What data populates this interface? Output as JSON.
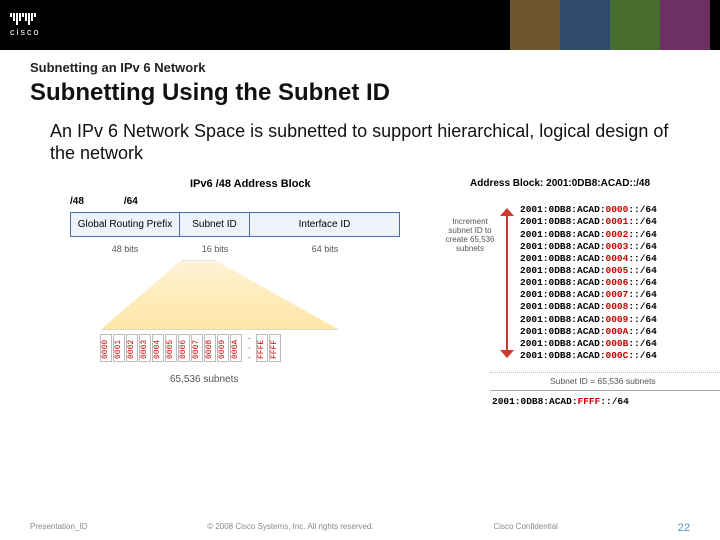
{
  "brand": "cisco",
  "kicker": "Subnetting an IPv 6 Network",
  "title": "Subnetting Using the Subnet ID",
  "body": "An IPv 6 Network Space is subnetted to support hierarchical, logical design of the network",
  "diagram": {
    "block_title": "IPv6 /48 Address Block",
    "row": {
      "a": "/48",
      "b": "/64"
    },
    "boxes": {
      "b1": "Global Routing Prefix",
      "b2": "Subnet ID",
      "b3": "Interface ID"
    },
    "bits": {
      "b1": "48 bits",
      "b2": "16 bits",
      "b3": "64 bits"
    },
    "subnet_ids": [
      "0000",
      "0001",
      "0002",
      "0003",
      "0004",
      "0005",
      "0006",
      "0007",
      "0008",
      "0009",
      "000A"
    ],
    "ellipsis": ". . .",
    "tail_ids": [
      "FFFE",
      "FFFF"
    ],
    "subcount": "65,536 subnets",
    "address_block_label": "Address Block: 2001:0DB8:ACAD::/48",
    "increment_note": "Increment subnet ID to create 65,536 subnets",
    "list_prefix": "2001:0DB8:ACAD:",
    "list_suffix": "::/64",
    "list_ids": [
      "0000",
      "0001",
      "0002",
      "0003",
      "0004",
      "0005",
      "0006",
      "0007",
      "0008",
      "0009",
      "000A",
      "000B",
      "000C"
    ],
    "list_note": "Subnet ID = 65,536 subnets",
    "last_prefix": "2001:0DB8:ACAD:",
    "last_id": "FFFF",
    "last_suffix": "::/64"
  },
  "footer": {
    "left": "Presentation_ID",
    "center": "© 2008 Cisco Systems, Inc. All rights reserved.",
    "right": "Cisco Confidential",
    "page": "22"
  }
}
